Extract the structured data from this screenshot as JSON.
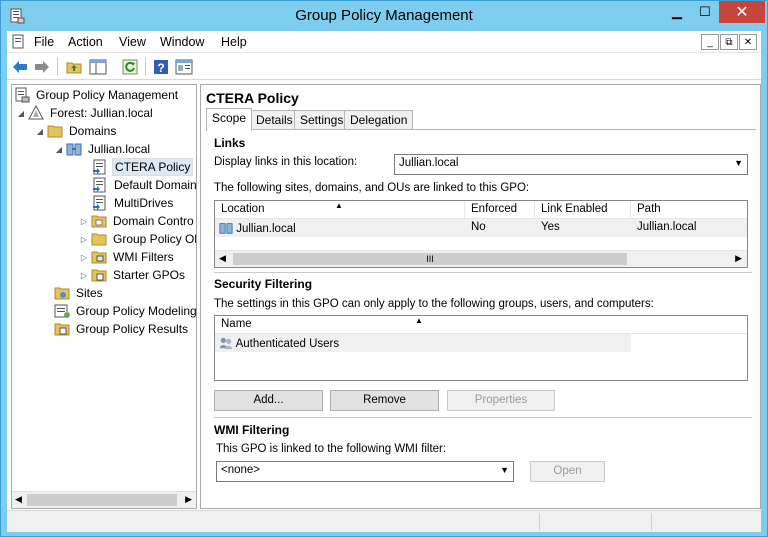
{
  "window": {
    "title": "Group Policy Management",
    "minimize_icon": "minimize-icon",
    "maximize_icon": "maximize-icon",
    "close_icon": "close-icon",
    "min_glyph": "▁",
    "max_glyph": "☐",
    "close_glyph": "✕"
  },
  "menu": {
    "items": [
      "File",
      "Action",
      "View",
      "Window",
      "Help"
    ],
    "mdi": {
      "min": "_",
      "restore": "⧉",
      "close": "✕"
    }
  },
  "toolbar": {
    "icons": [
      "back-arrow-icon",
      "forward-arrow-icon",
      "up-folder-icon",
      "show-hide-tree-icon",
      "refresh-icon",
      "help-icon",
      "properties-icon"
    ]
  },
  "tree": {
    "items": [
      {
        "label": "Group Policy Management",
        "icon": "gpm-root-icon",
        "expander": ""
      },
      {
        "label": "Forest: Jullian.local",
        "icon": "forest-icon",
        "expander": "◢"
      },
      {
        "label": "Domains",
        "icon": "folder-icon",
        "expander": "◢"
      },
      {
        "label": "Jullian.local",
        "icon": "domain-icon",
        "expander": "◢"
      },
      {
        "label": "CTERA Policy",
        "icon": "gpo-link-icon",
        "expander": ""
      },
      {
        "label": "Default Domain",
        "icon": "gpo-link-icon",
        "expander": ""
      },
      {
        "label": "MultiDrives",
        "icon": "gpo-link-icon",
        "expander": ""
      },
      {
        "label": "Domain Contro",
        "icon": "ou-folder-icon",
        "expander": "▷"
      },
      {
        "label": "Group Policy Ob",
        "icon": "folder-icon",
        "expander": "▷"
      },
      {
        "label": "WMI Filters",
        "icon": "folder-icon",
        "expander": "▷"
      },
      {
        "label": "Starter GPOs",
        "icon": "folder-icon",
        "expander": "▷"
      },
      {
        "label": "Sites",
        "icon": "sites-icon",
        "expander": ""
      },
      {
        "label": "Group Policy Modeling",
        "icon": "modeling-icon",
        "expander": ""
      },
      {
        "label": "Group Policy Results",
        "icon": "results-icon",
        "expander": ""
      }
    ]
  },
  "details": {
    "title": "CTERA Policy",
    "tabs": [
      "Scope",
      "Details",
      "Settings",
      "Delegation"
    ],
    "links": {
      "heading": "Links",
      "display_label": "Display links in this location:",
      "location_value": "Jullian.local",
      "description": "The following sites, domains, and OUs are linked to this GPO:",
      "columns": [
        "Location",
        "Enforced",
        "Link Enabled",
        "Path"
      ],
      "rows": [
        {
          "location": "Jullian.local",
          "enforced": "No",
          "link_enabled": "Yes",
          "path": "Jullian.local"
        }
      ]
    },
    "security": {
      "heading": "Security Filtering",
      "description": "The settings in this GPO can only apply to the following groups, users, and computers:",
      "columns": [
        "Name"
      ],
      "rows": [
        {
          "name": "Authenticated Users"
        }
      ],
      "buttons": {
        "add": "Add...",
        "remove": "Remove",
        "properties": "Properties"
      }
    },
    "wmi": {
      "heading": "WMI Filtering",
      "description": "This GPO is linked to the following WMI filter:",
      "value": "<none>",
      "open_button": "Open"
    }
  },
  "colors": {
    "title_bar": "#7fcdee",
    "close_button": "#c7453d",
    "selection": "#dde8f4"
  }
}
